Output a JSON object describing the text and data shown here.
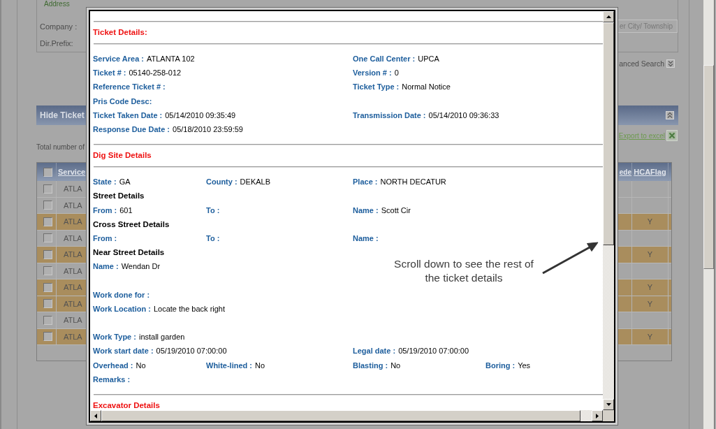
{
  "background_page": {
    "filter_panel": {
      "address_label": "Address",
      "company_label": "Company :",
      "dir_prefix_label": "Dir.Prefix:",
      "city_township_button": "er City/ Township"
    },
    "advanced_search_link": "anced Search",
    "results_panel": {
      "title": "Hide Ticket",
      "export_link": "Export to excel",
      "total_count_text": "Total number of",
      "table": {
        "columns": [
          "Service",
          "ede",
          "HCAFlag"
        ],
        "select_all": {
          "checked": false
        },
        "rows": [
          {
            "service": "ATLA",
            "checked": false,
            "highlighted": false
          },
          {
            "service": "ATLA",
            "checked": false,
            "highlighted": false
          },
          {
            "service": "ATLA",
            "checked": false,
            "highlighted": true,
            "hca_flag": "Y"
          },
          {
            "service": "ATLA",
            "checked": false,
            "highlighted": false
          },
          {
            "service": "ATLA",
            "checked": false,
            "highlighted": true,
            "hca_flag": "Y"
          },
          {
            "service": "ATLA",
            "checked": false,
            "highlighted": false
          },
          {
            "service": "ATLA",
            "checked": false,
            "highlighted": true,
            "hca_flag": "Y"
          },
          {
            "service": "ATLA",
            "checked": false,
            "highlighted": true,
            "hca_flag": "Y"
          },
          {
            "service": "ATLA",
            "checked": false,
            "highlighted": false
          },
          {
            "service": "ATLA",
            "checked": false,
            "highlighted": true,
            "hca_flag": "Y"
          }
        ]
      }
    }
  },
  "ticket_dialog": {
    "sections": [
      {
        "title": "Ticket Details:",
        "blocks": [
          {
            "rows": [
              {
                "kind": "fields",
                "col_1": {
                  "label": "Service Area :",
                  "value": "ATLANTA 102"
                },
                "col_3": {
                  "label": "One Call Center :",
                  "value": "UPCA"
                }
              },
              {
                "kind": "fields",
                "col_1": {
                  "label": "Ticket # :",
                  "value": "05140-258-012"
                },
                "col_3": {
                  "label": "Version # :",
                  "value": "0"
                }
              },
              {
                "kind": "fields",
                "col_1": {
                  "label": "Reference Ticket # :"
                },
                "col_3": {
                  "label": "Ticket Type :",
                  "value": "Normal Notice"
                }
              },
              {
                "kind": "fields",
                "col_1": {
                  "label": "Pris Code Desc:"
                }
              },
              {
                "kind": "fields",
                "col_1": {
                  "label": "Ticket Taken Date :",
                  "value": "05/14/2010 09:35:49"
                },
                "col_3": {
                  "label": "Transmission Date :",
                  "value": "05/14/2010 09:36:33"
                }
              },
              {
                "kind": "fields",
                "col_1": {
                  "label": "Response Due Date :",
                  "value": "05/18/2010 23:59:59"
                }
              }
            ]
          }
        ]
      },
      {
        "title": "Dig Site Details",
        "blocks": [
          {
            "rows": [
              {
                "kind": "fields",
                "col_1": {
                  "label": "State :",
                  "value": "GA"
                },
                "col_2": {
                  "label": "County :",
                  "value": "DEKALB"
                },
                "col_3": {
                  "label": "Place :",
                  "value": "NORTH DECATUR"
                }
              },
              {
                "kind": "subheading",
                "text": "Street Details"
              },
              {
                "kind": "fields",
                "col_1": {
                  "label": "From :",
                  "value": "601"
                },
                "col_2": {
                  "label": "To :"
                },
                "col_3": {
                  "label": "Name :",
                  "value": "Scott Cir"
                }
              },
              {
                "kind": "subheading",
                "text": "Cross Street Details"
              },
              {
                "kind": "fields",
                "col_1": {
                  "label": "From :"
                },
                "col_2": {
                  "label": "To :"
                },
                "col_3": {
                  "label": "Name :"
                }
              },
              {
                "kind": "subheading",
                "text": "Near Street Details"
              },
              {
                "kind": "fields",
                "col_1": {
                  "label": "Name :",
                  "value": "Wendan Dr"
                }
              }
            ]
          },
          {
            "rows": [
              {
                "kind": "fields",
                "col_1": {
                  "label": "Work done for :"
                }
              },
              {
                "kind": "fields",
                "col_1": {
                  "label": "Work Location :",
                  "value": "Locate the back right"
                }
              }
            ]
          },
          {
            "rows": [
              {
                "kind": "fields",
                "col_1": {
                  "label": "Work Type :",
                  "value": "install garden"
                }
              },
              {
                "kind": "fields",
                "col_1": {
                  "label": "Work start date :",
                  "value": "05/19/2010 07:00:00"
                },
                "col_3": {
                  "label": "Legal date :",
                  "value": "05/19/2010 07:00:00"
                }
              },
              {
                "kind": "fields",
                "col_1": {
                  "label": "Overhead :",
                  "value": "No"
                },
                "col_2": {
                  "label": "White-lined :",
                  "value": "No"
                },
                "col_3": {
                  "label": "Blasting :",
                  "value": "No"
                },
                "col_4": {
                  "label": "Boring :",
                  "value": "Yes"
                }
              },
              {
                "kind": "fields",
                "col_1": {
                  "label": "Remarks :"
                }
              }
            ]
          }
        ]
      },
      {
        "title": "Excavator Details"
      }
    ]
  },
  "callout": {
    "text": "Scroll down to see the rest of the ticket details"
  }
}
